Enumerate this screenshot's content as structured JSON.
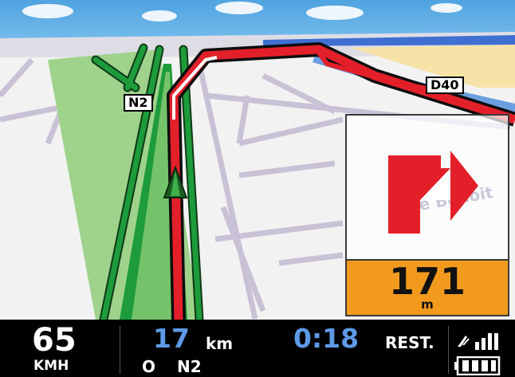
{
  "map": {
    "road_labels": [
      "N2",
      "D40"
    ],
    "street_name": "e Benoit"
  },
  "turn": {
    "icon": "turn-right-arrow-icon",
    "distance": "171",
    "unit": "m"
  },
  "status": {
    "speed": "65",
    "speed_unit": "KMH",
    "distance_remaining": "17",
    "distance_unit": "km",
    "direction": "O",
    "road": "N2",
    "time_remaining": "0:18",
    "time_label": "REST.",
    "signal_icon": "gps-signal-icon",
    "battery_icon": "battery-icon"
  },
  "colors": {
    "route": "#e3202a",
    "green_area": "#1e9b3a",
    "accent_blue": "#5e9ae6",
    "distance_bg": "#f29a1e"
  }
}
